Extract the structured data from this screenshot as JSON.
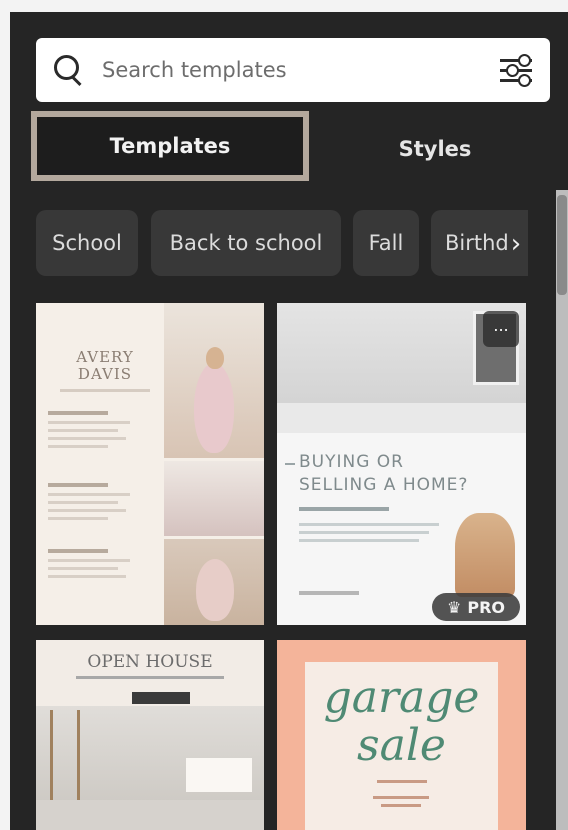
{
  "search": {
    "placeholder": "Search templates",
    "icon": "search-icon",
    "filter_icon": "sliders-icon"
  },
  "tabs": [
    {
      "label": "Templates",
      "selected": true
    },
    {
      "label": "Styles",
      "selected": false
    }
  ],
  "chips": [
    "School",
    "Back to school",
    "Fall",
    "Birthd"
  ],
  "templates": [
    {
      "name_line1": "AVERY",
      "name_line2": "DAVIS"
    },
    {
      "title_line1": "BUYING OR",
      "title_line2": "SELLING A HOME?",
      "more_label": "...",
      "badge_label": "PRO"
    },
    {
      "title": "OPEN HOUSE"
    },
    {
      "line1": "garage",
      "line2": "sale"
    }
  ],
  "colors": {
    "panel_bg": "#252525",
    "selected_tab_border": "#b3a89d",
    "chip_bg": "#383838",
    "garage_accent": "#4f8a74"
  }
}
